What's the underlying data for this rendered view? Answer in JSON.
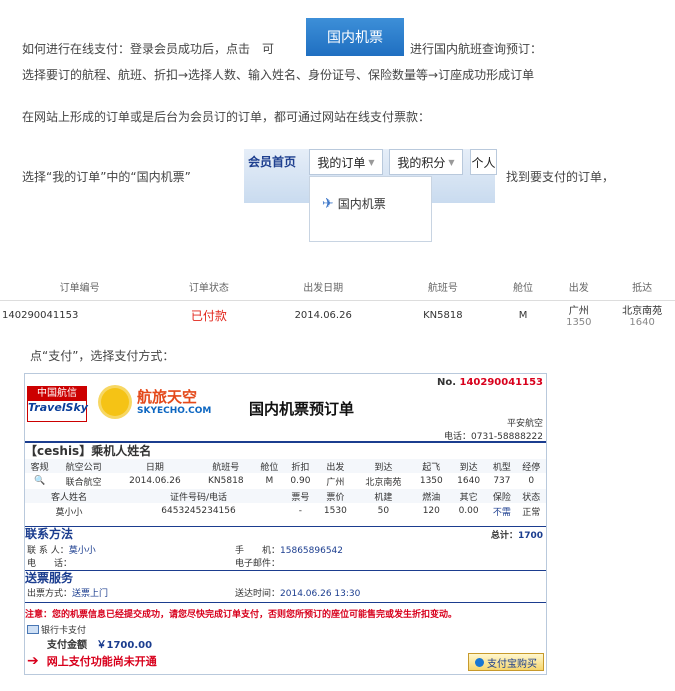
{
  "intro": {
    "line1_prefix": "如何进行在线支付：登录会员成功后，点击　可",
    "line1_button": "国内机票",
    "line1_suffix": "进行国内航班查询预订：",
    "line2": "选择要订的航程、航班、折扣→选择人数、输入姓名、身份证号、保险数量等→订座成功形成订单",
    "line3": "在网站上形成的订单或是后台为会员订的订单，都可通过网站在线支付票款：",
    "line4_prefix": "选择“我的订单”中的“国内机票”",
    "line4_suffix": "找到要支付的订单，"
  },
  "nav": {
    "home": "会员首页",
    "my_orders": "我的订单",
    "my_points": "我的积分",
    "more": "个人",
    "dropdown_item": "国内机票"
  },
  "orders_table": {
    "headers": [
      "订单编号",
      "订单状态",
      "出发日期",
      "航班号",
      "舱位",
      "出发",
      "抵达"
    ],
    "row": {
      "order_no": "140290041153",
      "status": "已付款",
      "date": "2014.06.26",
      "flight": "KN5818",
      "cabin": "M",
      "from": "广州",
      "from_time": "1350",
      "to": "北京南苑",
      "to_time": "1640"
    }
  },
  "step_text": "点“支付”，选择支付方式：",
  "ticket": {
    "logo_left_cn": "中国航信",
    "logo_left_en": "TravelSky",
    "logo_right_cn": "航旅天空",
    "logo_right_en": "SKYECHO.COM",
    "order_no_label": "No.",
    "order_no": "140290041153",
    "title": "国内机票预订单",
    "agency": "平安航空",
    "phone": "电话：0731-58888222",
    "passenger_section": "【ceshis】乘机人姓名",
    "flight_headers": [
      "客规",
      "航空公司",
      "日期",
      "航班号",
      "舱位",
      "折扣",
      "出发",
      "到达",
      "起飞",
      "到达",
      "机型",
      "经停"
    ],
    "flight_row": [
      "联合航空",
      "2014.06.26",
      "KN5818",
      "M",
      "0.90",
      "广州",
      "北京南苑",
      "1350",
      "1640",
      "737",
      "0"
    ],
    "pax_headers": [
      "客人姓名",
      "证件号码/电话",
      "票号",
      "票价",
      "机建",
      "燃油",
      "其它",
      "保险",
      "状态"
    ],
    "pax_row": [
      "莫小小",
      "6453245234156",
      "-",
      "1530",
      "50",
      "120",
      "0.00",
      "不需",
      "正常"
    ],
    "contact_section": "联系方法",
    "total_label": "总计：",
    "total": "1700",
    "contact_label": "联 系 人：",
    "contact_name": "莫小小",
    "mobile_label": "手　　机：",
    "mobile": "15865896542",
    "tel_label": "电　　话：",
    "email_label": "电子邮件：",
    "delivery_section": "送票服务",
    "delivery_label": "出票方式：",
    "delivery_value": "送票上门",
    "delivery_time_label": "送达时间：",
    "delivery_time": "2014.06.26 13:30",
    "notice": "注意：您的机票信息已经提交成功，请您尽快完成订单支付，否则您所预订的座位可能售完或发生折扣变动。",
    "bank_label": "银行卡支付",
    "pay_amount_label": "支付金额",
    "pay_amount": "￥1700.00",
    "alipay_button": "支付宝购买",
    "online_pay_notice": "网上支付功能尚未开通"
  },
  "colors": {
    "accent_blue": "#1f6fc1",
    "paid_red": "#e1251b",
    "ticket_blue": "#1b3d8f",
    "ticket_red": "#d8001c"
  }
}
